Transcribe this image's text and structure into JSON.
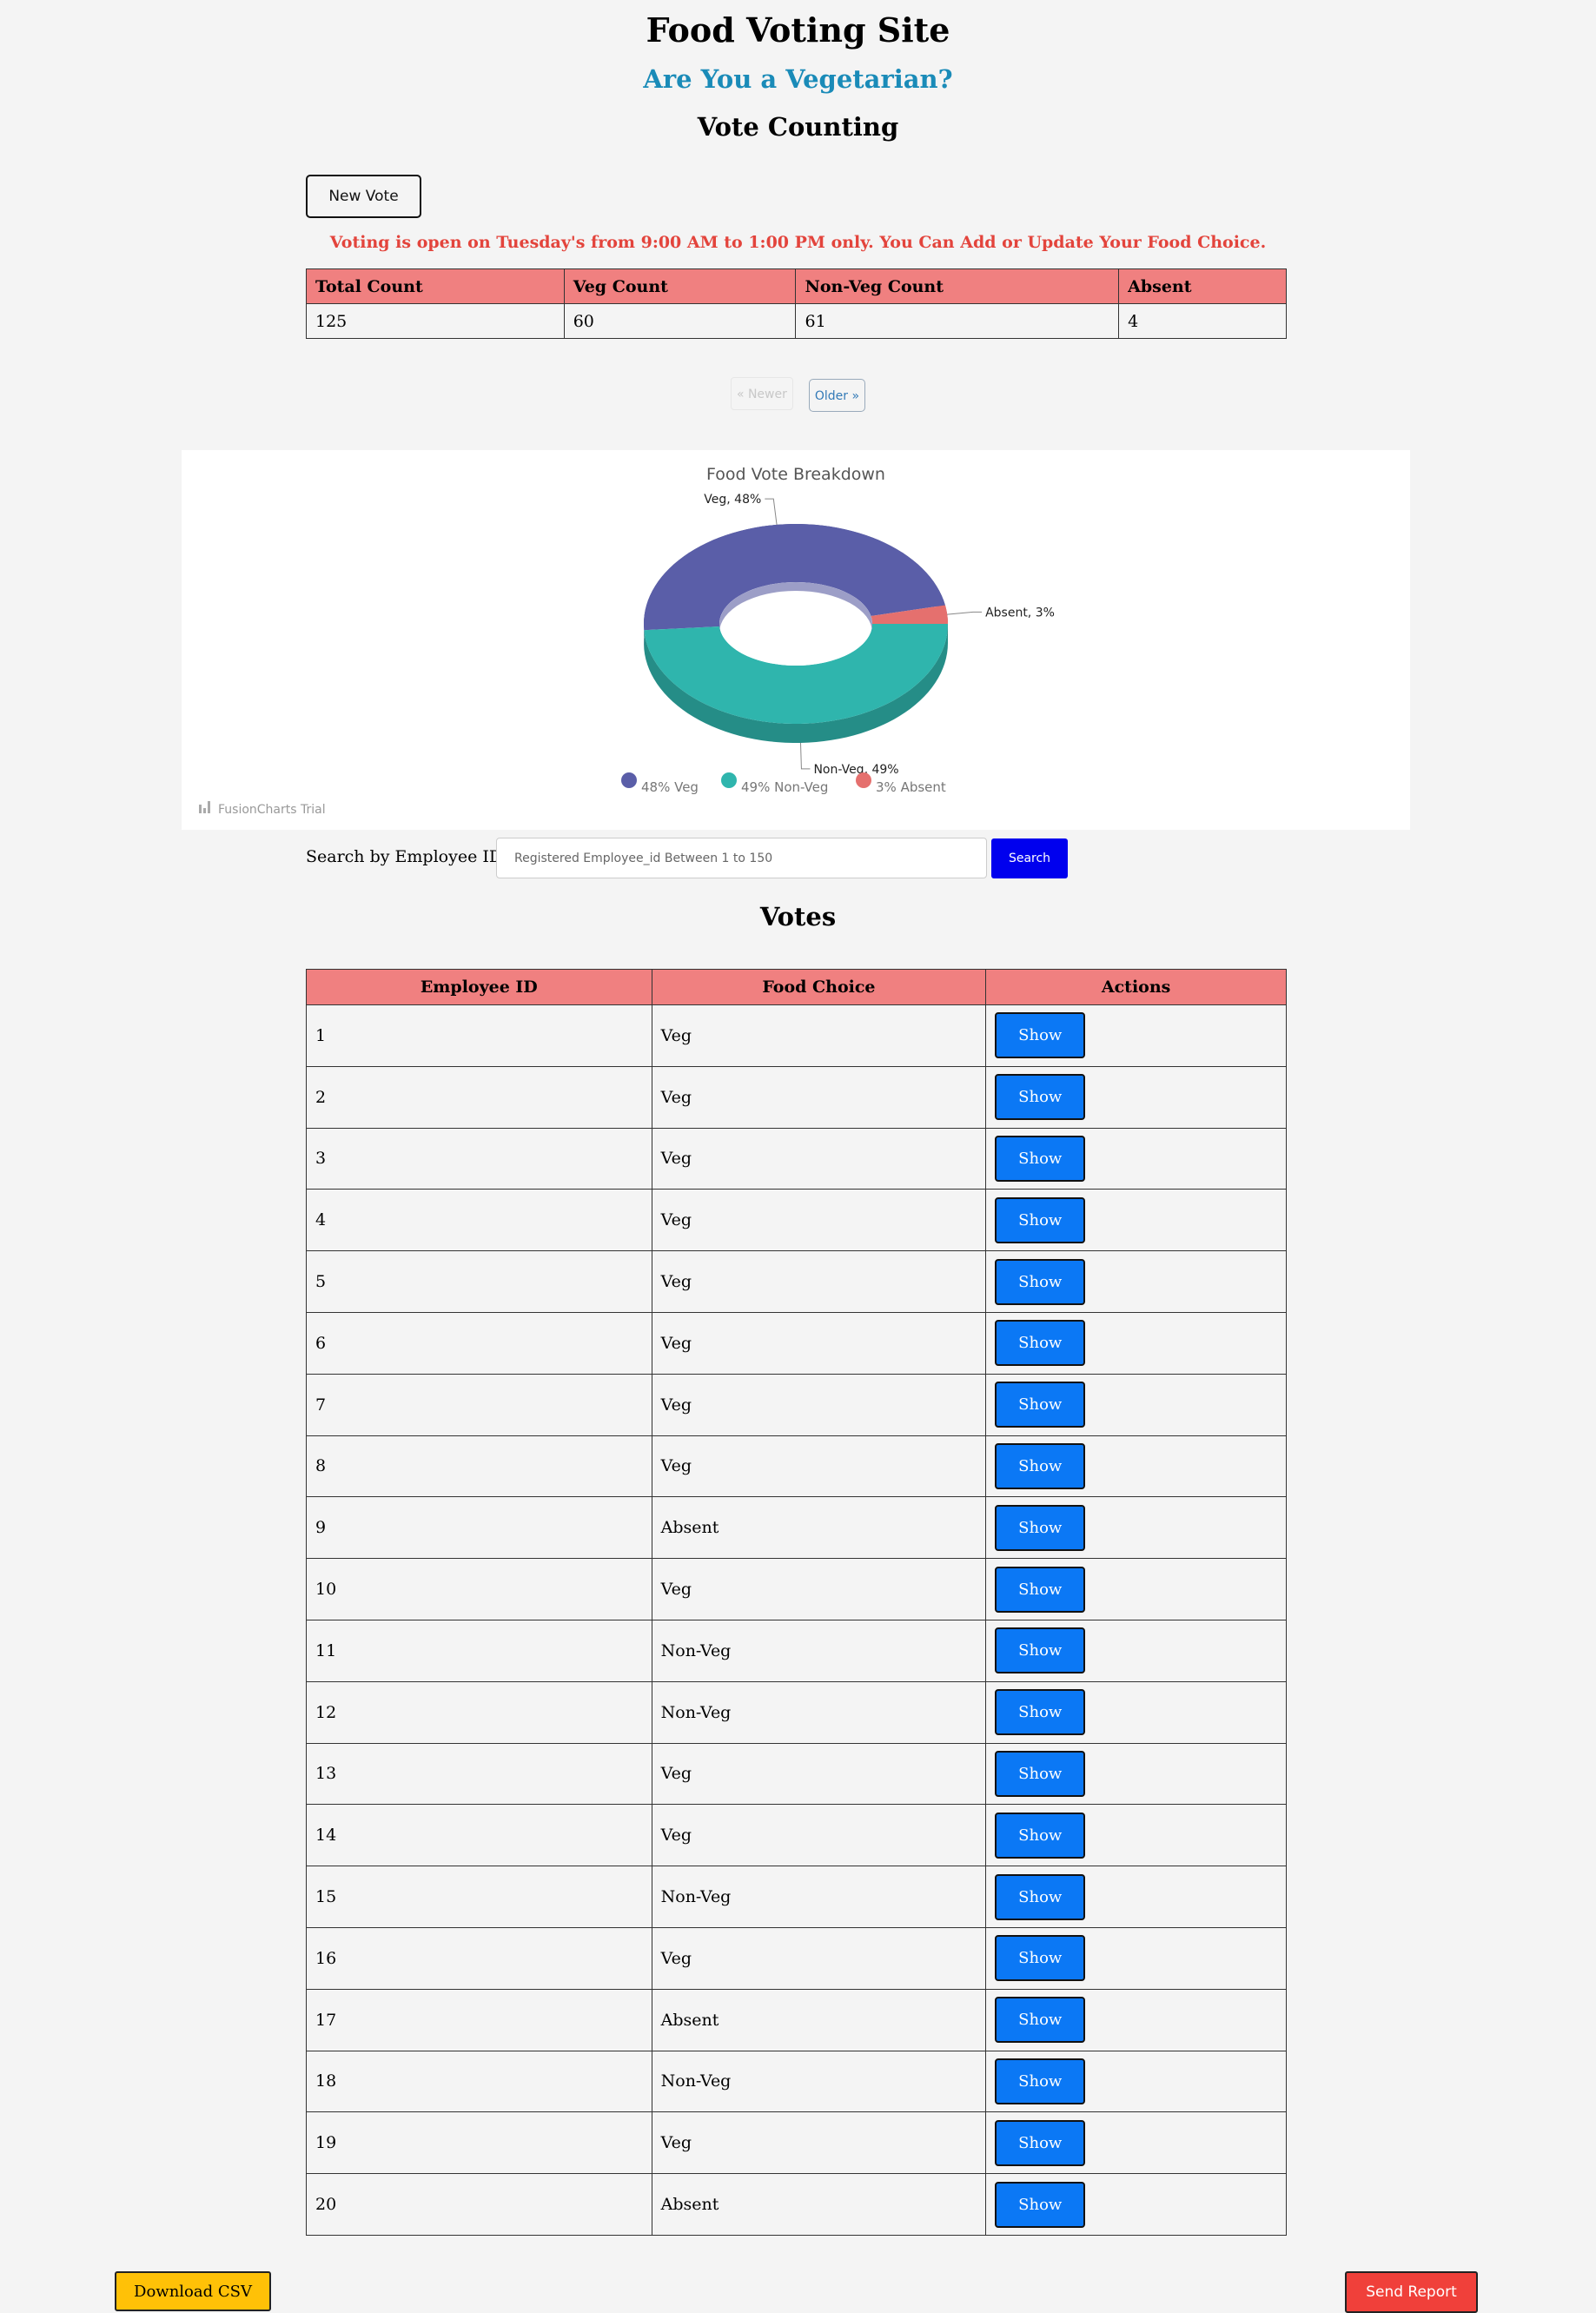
{
  "header": {
    "title": "Food Voting Site",
    "question": "Are You a Vegetarian?",
    "section": "Vote Counting"
  },
  "new_vote_label": "New Vote",
  "notice": "Voting is open on Tuesday's from 9:00 AM to 1:00 PM only. You Can Add or Update Your Food Choice.",
  "counts": {
    "headers": [
      "Total Count",
      "Veg Count",
      "Non-Veg Count",
      "Absent"
    ],
    "values": [
      "125",
      "60",
      "61",
      "4"
    ]
  },
  "pager": {
    "newer": "« Newer",
    "older": "Older »"
  },
  "chart_data": {
    "type": "pie",
    "title": "Food Vote Breakdown",
    "categories": [
      "Veg",
      "Non-Veg",
      "Absent"
    ],
    "values": [
      48,
      49,
      3
    ],
    "unit": "%",
    "slice_labels": [
      "Veg, 48%",
      "Non-Veg, 49%",
      "Absent, 3%"
    ],
    "legend": [
      "48% Veg",
      "49% Non-Veg",
      "3% Absent"
    ],
    "legend_position": "bottom",
    "colors": [
      "#5a5ea8",
      "#2fb5ad",
      "#e5706e"
    ]
  },
  "watermark": "FusionCharts Trial",
  "search": {
    "label": "Search by Employee ID:",
    "placeholder": "Registered Employee_id Between 1 to 150",
    "button": "Search"
  },
  "votes": {
    "title": "Votes",
    "headers": [
      "Employee ID",
      "Food Choice",
      "Actions"
    ],
    "action_label": "Show",
    "rows": [
      {
        "id": "1",
        "choice": "Veg"
      },
      {
        "id": "2",
        "choice": "Veg"
      },
      {
        "id": "3",
        "choice": "Veg"
      },
      {
        "id": "4",
        "choice": "Veg"
      },
      {
        "id": "5",
        "choice": "Veg"
      },
      {
        "id": "6",
        "choice": "Veg"
      },
      {
        "id": "7",
        "choice": "Veg"
      },
      {
        "id": "8",
        "choice": "Veg"
      },
      {
        "id": "9",
        "choice": "Absent"
      },
      {
        "id": "10",
        "choice": "Veg"
      },
      {
        "id": "11",
        "choice": "Non-Veg"
      },
      {
        "id": "12",
        "choice": "Non-Veg"
      },
      {
        "id": "13",
        "choice": "Veg"
      },
      {
        "id": "14",
        "choice": "Veg"
      },
      {
        "id": "15",
        "choice": "Non-Veg"
      },
      {
        "id": "16",
        "choice": "Veg"
      },
      {
        "id": "17",
        "choice": "Absent"
      },
      {
        "id": "18",
        "choice": "Non-Veg"
      },
      {
        "id": "19",
        "choice": "Veg"
      },
      {
        "id": "20",
        "choice": "Absent"
      }
    ]
  },
  "footer": {
    "download": "Download CSV",
    "report": "Send Report"
  }
}
